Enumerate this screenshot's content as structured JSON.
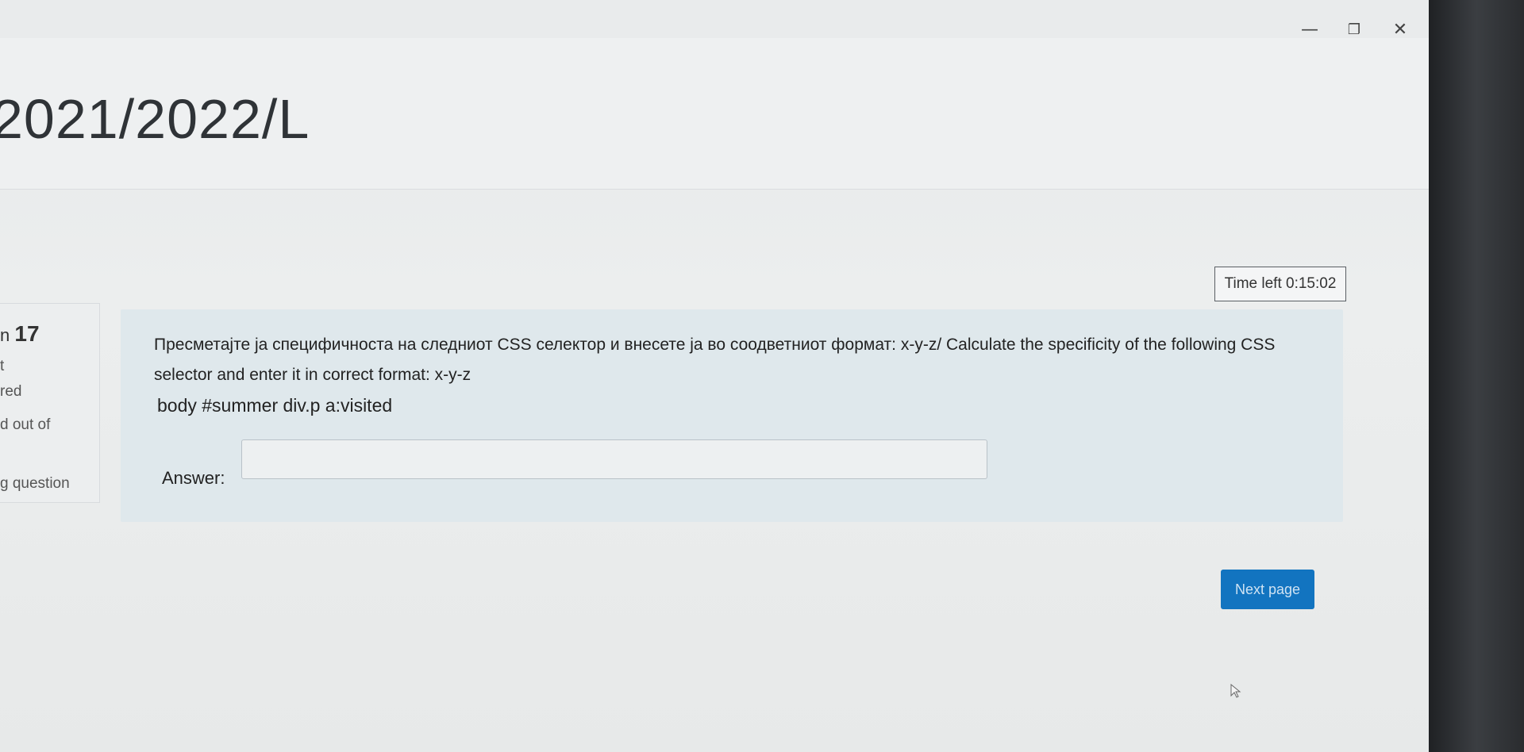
{
  "window": {
    "minimize_glyph": "—",
    "maximize_glyph": "❐",
    "close_glyph": "✕"
  },
  "page": {
    "course_title": "2021/2022/L"
  },
  "timer": {
    "label": "Time left 0:15:02"
  },
  "question_info": {
    "number_prefix": "n",
    "number": "17",
    "line1": "t",
    "line2": "red",
    "line3": "d out of",
    "flag_label": "g question"
  },
  "question": {
    "text": "Пресметајте ја специфичноста на следниот CSS селектор и внесете ја во соодветниот формат: x-y-z/ Calculate the specificity of the following CSS selector and enter it in correct format: x-y-z",
    "selector": "body #summer div.p a:visited",
    "answer_label": "Answer:",
    "answer_value": ""
  },
  "navigation": {
    "next_label": "Next page"
  },
  "icons": {
    "cursor": "mouse-pointer-icon"
  }
}
